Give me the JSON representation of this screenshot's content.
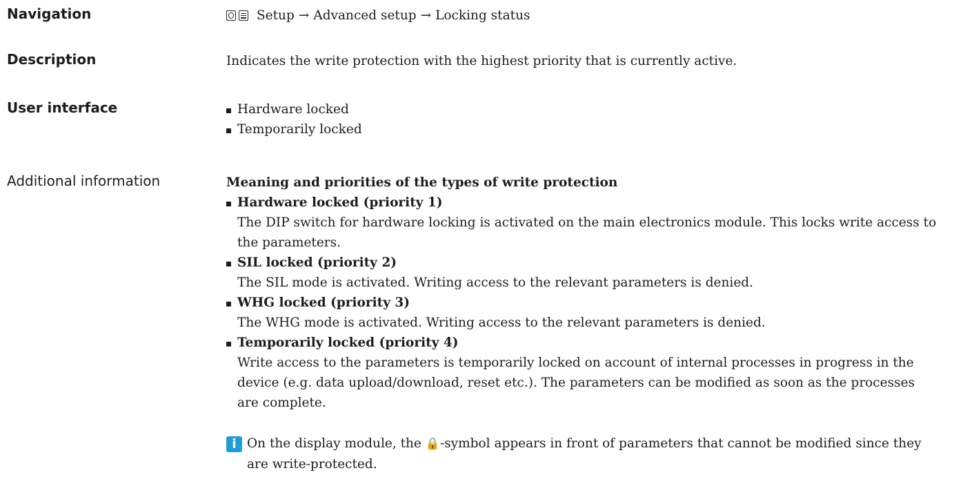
{
  "navigation": {
    "label": "Navigation",
    "icons": [
      "display-icon",
      "list-icon"
    ],
    "path": [
      "Setup",
      "Advanced setup",
      "Locking status"
    ],
    "separator": "→"
  },
  "description": {
    "label": "Description",
    "text": "Indicates the write protection with the highest priority that is currently active."
  },
  "user_interface": {
    "label": "User interface",
    "items": [
      "Hardware locked",
      "Temporarily locked"
    ]
  },
  "additional_information": {
    "label": "Additional information",
    "title": "Meaning and priorities of the types of write protection",
    "items": [
      {
        "title": "Hardware locked (priority 1)",
        "text": "The DIP switch for hardware locking is activated on the main electronics module. This locks write access to the parameters."
      },
      {
        "title": "SIL locked (priority 2)",
        "text": "The SIL mode is activated. Writing access to the relevant parameters is denied."
      },
      {
        "title": "WHG locked (priority 3)",
        "text": "The WHG mode is activated. Writing access to the relevant parameters is denied."
      },
      {
        "title": "Temporarily locked (priority 4)",
        "text": "Write access to the parameters is temporarily locked on account of internal processes in progress in the device (e.g. data upload/download, reset etc.). The parameters can be modified as soon as the processes are complete."
      }
    ],
    "note": {
      "icon": "info-icon",
      "before": "On the display module, the ",
      "glyph": "🔒",
      "after": "-symbol appears in front of parameters that cannot be modified since they are write-protected."
    }
  },
  "colors": {
    "info_icon": "#1f9bd7",
    "text": "#1c1c1c"
  }
}
